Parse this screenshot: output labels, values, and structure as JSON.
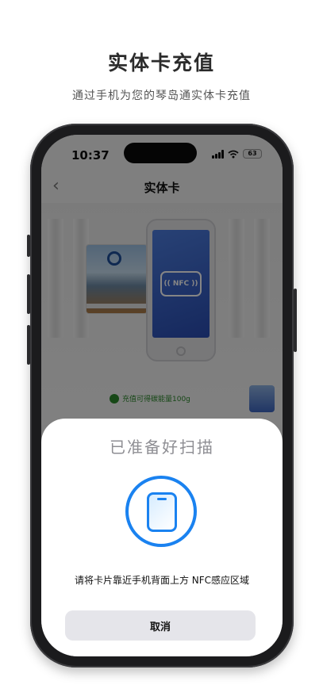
{
  "promo": {
    "title": "实体卡充值",
    "subtitle": "通过手机为您的琴岛通实体卡充值"
  },
  "status_bar": {
    "time": "10:37",
    "battery": "63"
  },
  "nav": {
    "back_icon": "chevron-left",
    "title": "实体卡"
  },
  "illustration": {
    "nfc_label": "(( NFC ))",
    "perk_text": "充值可得碳能量100g"
  },
  "nfc_sheet": {
    "title": "已准备好扫描",
    "instruction": "请将卡片靠近手机背面上方 NFC感应区域",
    "cancel_label": "取消",
    "accent_color": "#1a82f0"
  }
}
